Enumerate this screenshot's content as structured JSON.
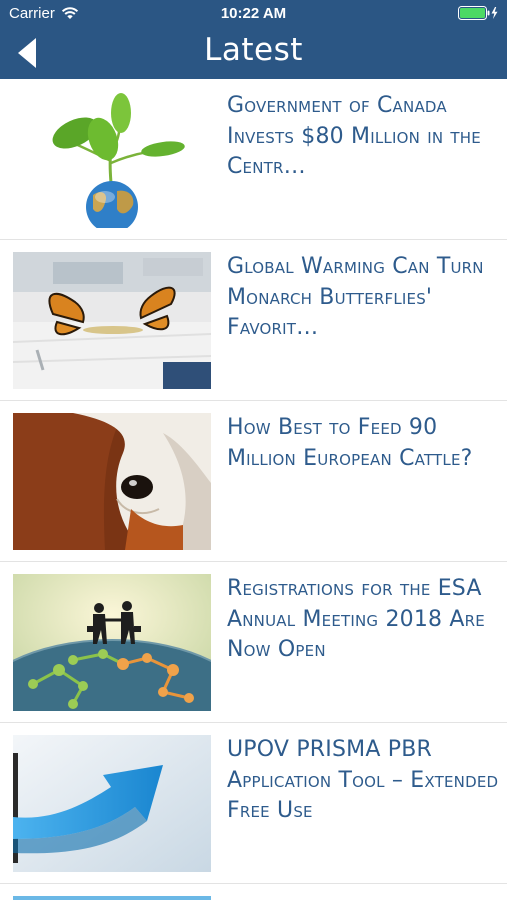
{
  "status_bar": {
    "carrier": "Carrier",
    "time": "10:22 AM",
    "battery_color": "#4cd964"
  },
  "nav": {
    "title": "Latest",
    "back_icon": "chevron-left-icon"
  },
  "colors": {
    "header_bg": "#2b5684",
    "title_text": "#2e5b8c"
  },
  "articles": [
    {
      "title": "Government of Canada Invests $80 Million in the Centr…",
      "image": "seedling-globe"
    },
    {
      "title": "Global Warming Can Turn Monarch Butterflies' Favorit…",
      "image": "monarch-butterflies"
    },
    {
      "title": "How Best to Feed 90 Million European Cattle?",
      "image": "cow-closeup"
    },
    {
      "title": "Registrations for the ESA Annual Meeting 2018 Are Now Open",
      "image": "handshake-globe-network"
    },
    {
      "title": "UPOV PRISMA PBR Application Tool – Extended Free Use",
      "image": "blue-arrow"
    }
  ]
}
